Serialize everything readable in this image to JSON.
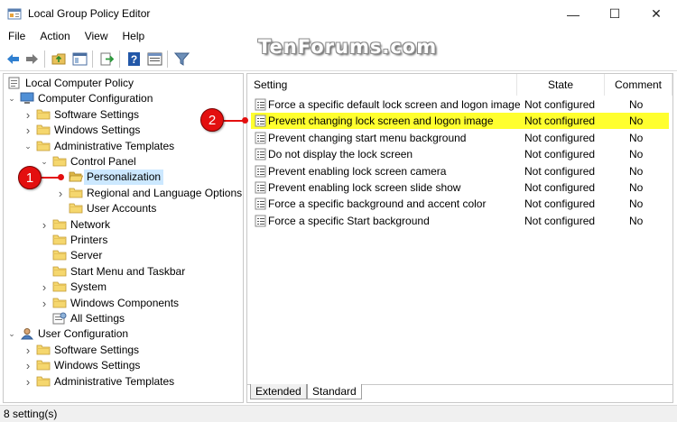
{
  "window": {
    "title": "Local Group Policy Editor",
    "controls": {
      "minimize": "—",
      "maximize": "☐",
      "close": "✕"
    }
  },
  "watermark": "TenForums.com",
  "menu": [
    "File",
    "Action",
    "View",
    "Help"
  ],
  "toolbar": [
    "back-icon",
    "forward-icon",
    "up-folder-icon",
    "show-hide-tree-icon",
    "export-list-icon",
    "help-icon",
    "properties-icon",
    "filter-icon"
  ],
  "tree": [
    {
      "label": "Local Computer Policy",
      "depth": 0,
      "icon": "computer-policy-icon",
      "expander": ""
    },
    {
      "label": "Computer Configuration",
      "depth": 1,
      "icon": "computer-icon",
      "expander": "expanded"
    },
    {
      "label": "Software Settings",
      "depth": 2,
      "icon": "folder-icon",
      "expander": "collapsed"
    },
    {
      "label": "Windows Settings",
      "depth": 2,
      "icon": "folder-icon",
      "expander": "collapsed"
    },
    {
      "label": "Administrative Templates",
      "depth": 2,
      "icon": "folder-icon",
      "expander": "expanded"
    },
    {
      "label": "Control Panel",
      "depth": 3,
      "icon": "folder-icon",
      "expander": "expanded"
    },
    {
      "label": "Personalization",
      "depth": 4,
      "icon": "folder-open-icon",
      "expander": "",
      "selected": true
    },
    {
      "label": "Regional and Language Options",
      "depth": 4,
      "icon": "folder-icon",
      "expander": "collapsed"
    },
    {
      "label": "User Accounts",
      "depth": 4,
      "icon": "folder-icon",
      "expander": ""
    },
    {
      "label": "Network",
      "depth": 3,
      "icon": "folder-icon",
      "expander": "collapsed"
    },
    {
      "label": "Printers",
      "depth": 3,
      "icon": "folder-icon",
      "expander": ""
    },
    {
      "label": "Server",
      "depth": 3,
      "icon": "folder-icon",
      "expander": ""
    },
    {
      "label": "Start Menu and Taskbar",
      "depth": 3,
      "icon": "folder-icon",
      "expander": ""
    },
    {
      "label": "System",
      "depth": 3,
      "icon": "folder-icon",
      "expander": "collapsed"
    },
    {
      "label": "Windows Components",
      "depth": 3,
      "icon": "folder-icon",
      "expander": "collapsed"
    },
    {
      "label": "All Settings",
      "depth": 3,
      "icon": "all-settings-icon",
      "expander": ""
    },
    {
      "label": "User Configuration",
      "depth": 1,
      "icon": "user-icon",
      "expander": "expanded"
    },
    {
      "label": "Software Settings",
      "depth": 2,
      "icon": "folder-icon",
      "expander": "collapsed"
    },
    {
      "label": "Windows Settings",
      "depth": 2,
      "icon": "folder-icon",
      "expander": "collapsed"
    },
    {
      "label": "Administrative Templates",
      "depth": 2,
      "icon": "folder-icon",
      "expander": "collapsed"
    }
  ],
  "list": {
    "columns": [
      "Setting",
      "State",
      "Comment"
    ],
    "rows": [
      {
        "setting": "Force a specific default lock screen and logon image",
        "state": "Not configured",
        "comment": "No"
      },
      {
        "setting": "Prevent changing lock screen and logon image",
        "state": "Not configured",
        "comment": "No",
        "highlighted": true
      },
      {
        "setting": "Prevent changing start menu background",
        "state": "Not configured",
        "comment": "No"
      },
      {
        "setting": "Do not display the lock screen",
        "state": "Not configured",
        "comment": "No"
      },
      {
        "setting": "Prevent enabling lock screen camera",
        "state": "Not configured",
        "comment": "No"
      },
      {
        "setting": "Prevent enabling lock screen slide show",
        "state": "Not configured",
        "comment": "No"
      },
      {
        "setting": "Force a specific background and accent color",
        "state": "Not configured",
        "comment": "No"
      },
      {
        "setting": "Force a specific Start background",
        "state": "Not configured",
        "comment": "No"
      }
    ]
  },
  "tabs": [
    {
      "label": "Extended",
      "active": false
    },
    {
      "label": "Standard",
      "active": true
    }
  ],
  "status": "8 setting(s)",
  "callouts": [
    "1",
    "2"
  ],
  "colors": {
    "highlight": "#ffff2e",
    "selection": "#cce8ff",
    "callout": "#e30f0f",
    "folder": "#f5d76e"
  }
}
